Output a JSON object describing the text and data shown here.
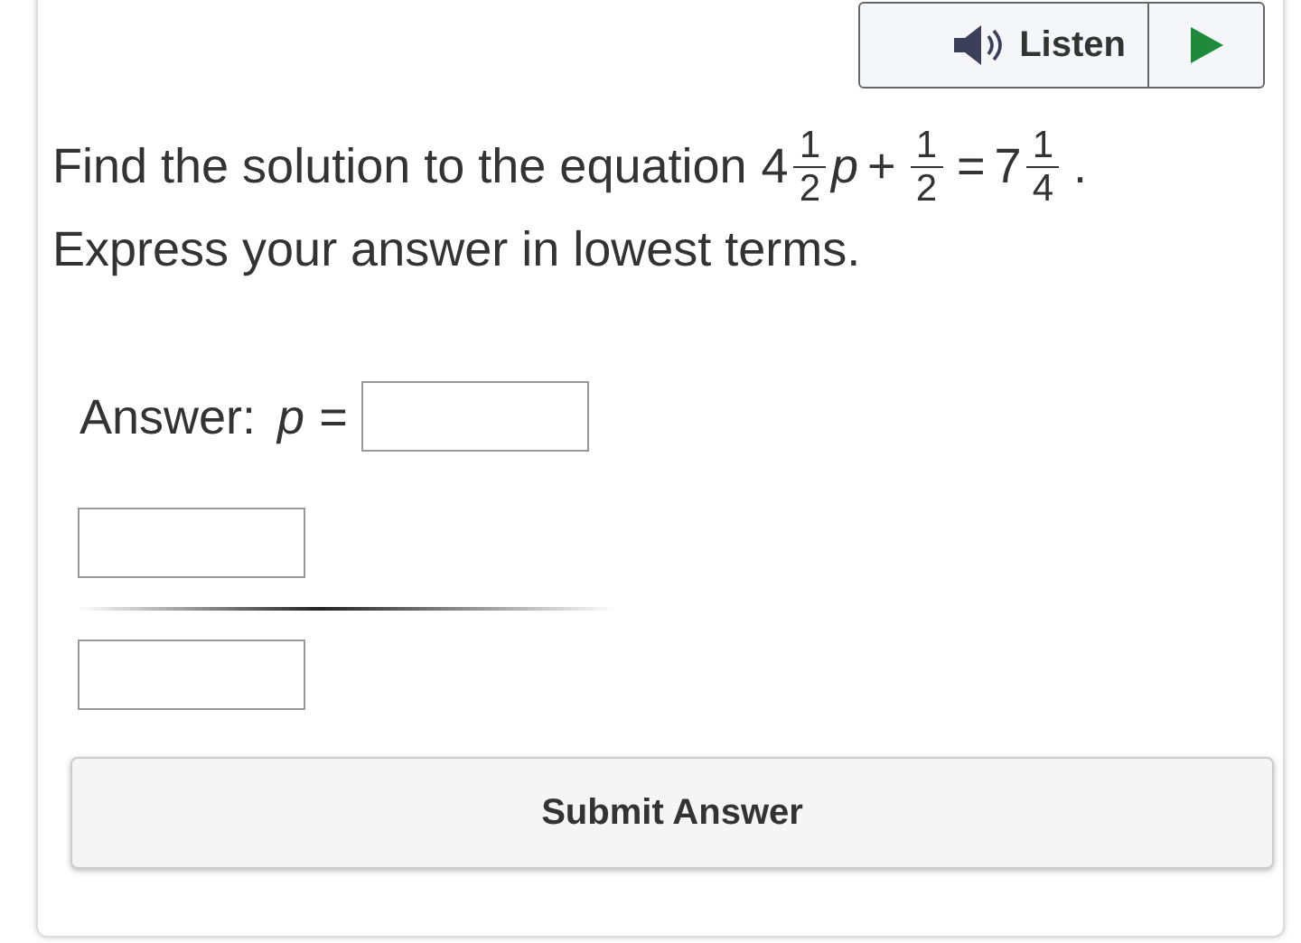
{
  "listen_button": {
    "label": "Listen"
  },
  "question": {
    "lead": "Find the solution to the equation",
    "equation": [
      {
        "kind": "num",
        "text": "4"
      },
      {
        "kind": "frac",
        "num": "1",
        "den": "2"
      },
      {
        "kind": "var",
        "text": "p"
      },
      {
        "kind": "op",
        "text": "+"
      },
      {
        "kind": "frac",
        "num": "1",
        "den": "2"
      },
      {
        "kind": "op",
        "text": "="
      },
      {
        "kind": "num",
        "text": "7"
      },
      {
        "kind": "frac",
        "num": "1",
        "den": "4"
      },
      {
        "kind": "op",
        "text": "."
      }
    ],
    "instruction": "Express your answer in lowest terms."
  },
  "answer": {
    "label": "Answer:",
    "variable": "p",
    "equals": "="
  },
  "submit_button": {
    "label": "Submit Answer"
  }
}
